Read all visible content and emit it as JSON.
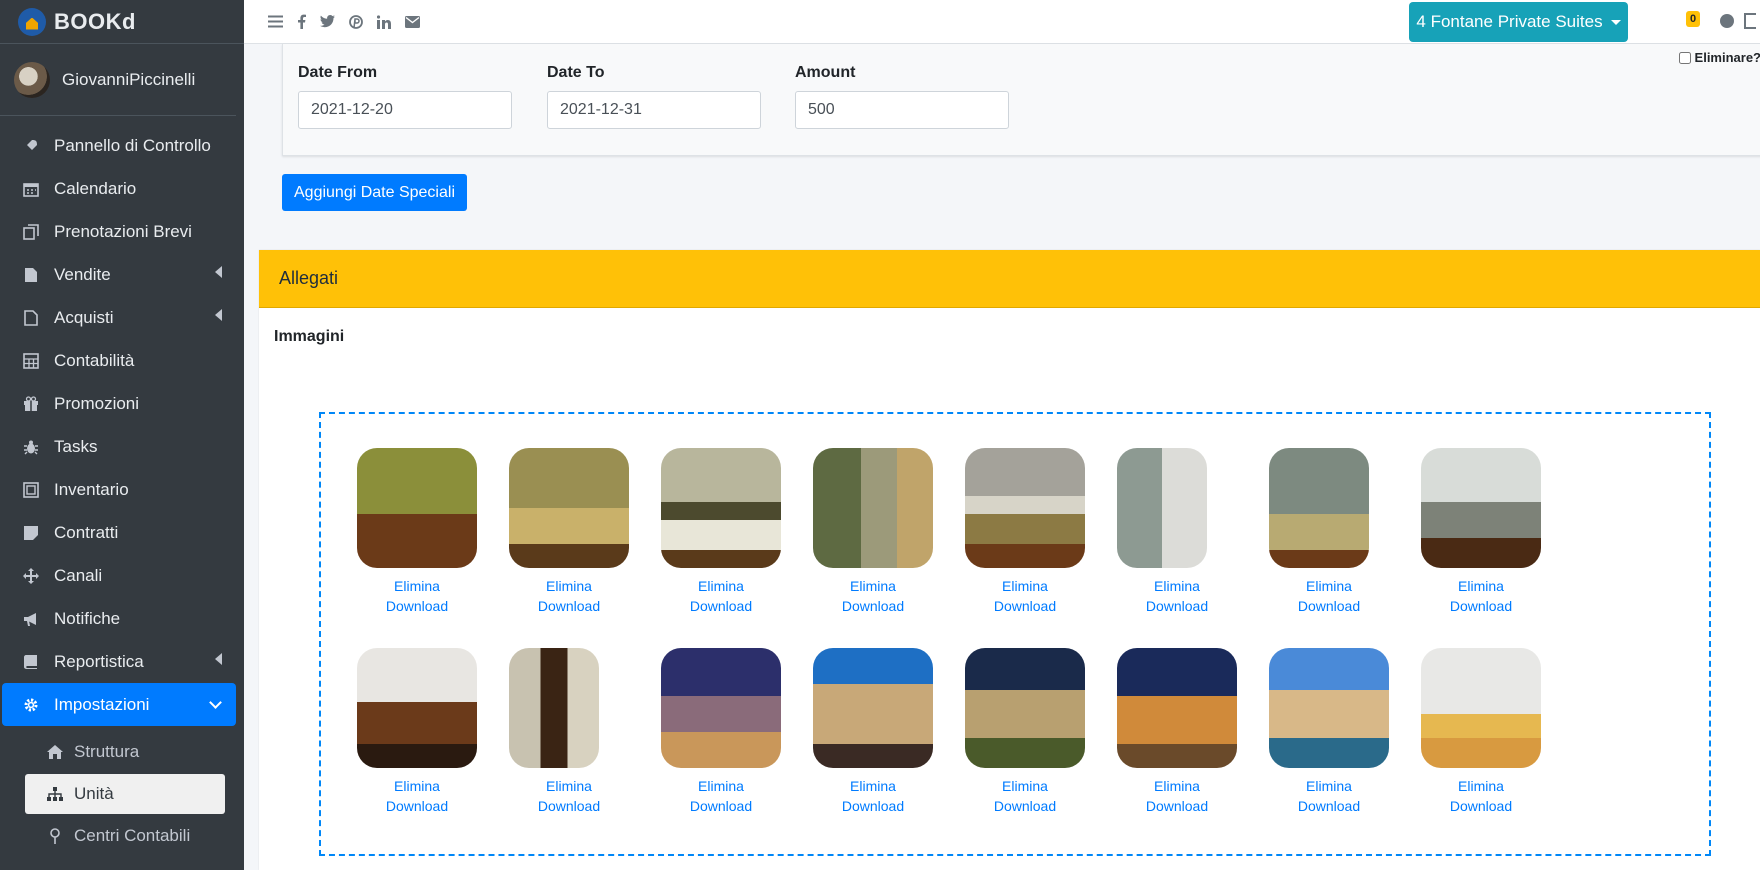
{
  "brand": {
    "name": "BOOKd"
  },
  "user": {
    "name": "GiovanniPiccinelli"
  },
  "sidebar": {
    "items": [
      {
        "label": "Pannello di Controllo",
        "icon": "rocket-icon"
      },
      {
        "label": "Calendario",
        "icon": "calendar-icon"
      },
      {
        "label": "Prenotazioni Brevi",
        "icon": "copy-icon"
      },
      {
        "label": "Vendite",
        "icon": "file-icon"
      },
      {
        "label": "Acquisti",
        "icon": "file-outline-icon"
      },
      {
        "label": "Contabilità",
        "icon": "calculator-icon"
      },
      {
        "label": "Promozioni",
        "icon": "gift-icon"
      },
      {
        "label": "Tasks",
        "icon": "bug-icon"
      },
      {
        "label": "Inventario",
        "icon": "inventory-icon"
      },
      {
        "label": "Contratti",
        "icon": "sticky-note-icon"
      },
      {
        "label": "Canali",
        "icon": "arrows-icon"
      },
      {
        "label": "Notifiche",
        "icon": "bullhorn-icon"
      },
      {
        "label": "Reportistica",
        "icon": "book-icon"
      },
      {
        "label": "Impostazioni",
        "icon": "gear-icon"
      }
    ],
    "subitems": [
      {
        "label": "Struttura",
        "icon": "home-icon"
      },
      {
        "label": "Unità",
        "icon": "sitemap-icon"
      },
      {
        "label": "Centri Contabili",
        "icon": "map-pin-icon"
      }
    ]
  },
  "topbar": {
    "property": "4 Fontane Private Suites",
    "notification_count": "0"
  },
  "special_dates": {
    "delete_label": "Eliminare?",
    "date_from_label": "Date From",
    "date_from_value": "2021-12-20",
    "date_to_label": "Date To",
    "date_to_value": "2021-12-31",
    "amount_label": "Amount",
    "amount_value": "500",
    "add_button": "Aggiungi Date Speciali"
  },
  "attachments": {
    "header": "Allegati",
    "images_title": "Immagini",
    "delete_link": "Elimina",
    "download_link": "Download",
    "images": [
      {
        "name": "room-bedroom-1"
      },
      {
        "name": "room-bedroom-2"
      },
      {
        "name": "room-bedroom-3"
      },
      {
        "name": "room-bedroom-4"
      },
      {
        "name": "room-twin-beds"
      },
      {
        "name": "bathroom-1"
      },
      {
        "name": "bathroom-2"
      },
      {
        "name": "living-room"
      },
      {
        "name": "kitchen"
      },
      {
        "name": "hallway"
      },
      {
        "name": "castel-santangelo"
      },
      {
        "name": "pantheon"
      },
      {
        "name": "colosseum"
      },
      {
        "name": "piazza-night"
      },
      {
        "name": "trevi-fountain"
      },
      {
        "name": "yellow-sofa"
      }
    ]
  },
  "colors": {
    "sidebar_bg": "#343a40",
    "primary": "#007bff",
    "info": "#17a2b8",
    "warning": "#ffc107"
  }
}
